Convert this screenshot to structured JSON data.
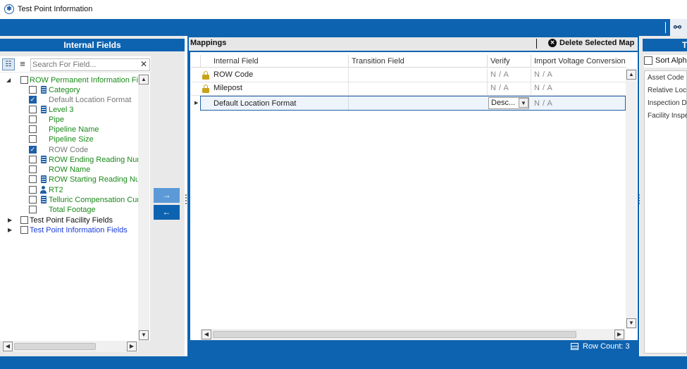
{
  "window": {
    "title": "Test Point Information",
    "app_icon": "asterisk-circle-icon"
  },
  "toolbar": {
    "right_icon": "binoculars-icon"
  },
  "left_panel": {
    "title": "Internal Fields",
    "search_placeholder": "Search For Field...",
    "clear_label": "✕",
    "tree": [
      {
        "label": "ROW Permanent Information Fie",
        "level": 0,
        "expanded": true,
        "checked": false,
        "color": "green"
      },
      {
        "label": "Category",
        "level": 1,
        "checked": false,
        "icon": "calculator-icon",
        "color": "green"
      },
      {
        "label": "Default Location Format",
        "level": 1,
        "checked": true,
        "color": "gray"
      },
      {
        "label": "Level 3",
        "level": 1,
        "checked": false,
        "icon": "calculator-icon",
        "color": "green"
      },
      {
        "label": "Pipe",
        "level": 1,
        "checked": false,
        "color": "green"
      },
      {
        "label": "Pipeline Name",
        "level": 1,
        "checked": false,
        "color": "green"
      },
      {
        "label": "Pipeline Size",
        "level": 1,
        "checked": false,
        "color": "green"
      },
      {
        "label": "ROW Code",
        "level": 1,
        "checked": true,
        "color": "gray"
      },
      {
        "label": "ROW Ending Reading Num",
        "level": 1,
        "checked": false,
        "icon": "calculator-icon",
        "color": "green"
      },
      {
        "label": "ROW Name",
        "level": 1,
        "checked": false,
        "color": "green"
      },
      {
        "label": "ROW Starting Reading Nur",
        "level": 1,
        "checked": false,
        "icon": "calculator-icon",
        "color": "green"
      },
      {
        "label": "RT2",
        "level": 1,
        "checked": false,
        "icon": "person-icon",
        "color": "green"
      },
      {
        "label": "Telluric Compensation Curr",
        "level": 1,
        "checked": false,
        "icon": "calculator-icon",
        "color": "green"
      },
      {
        "label": "Total Footage",
        "level": 1,
        "checked": false,
        "color": "green"
      },
      {
        "label": "Test Point Facility Fields",
        "level": 0,
        "expanded": false,
        "checked": false,
        "color": "dark"
      },
      {
        "label": "Test Point Information Fields",
        "level": 0,
        "expanded": false,
        "checked": false,
        "color": "blue"
      }
    ]
  },
  "transfer": {
    "add_label": "→",
    "remove_label": "←"
  },
  "mappings": {
    "title": "Mappings",
    "delete_label": "Delete Selected Map",
    "columns": [
      "Internal Field",
      "Transition Field",
      "Verify",
      "Import Voltage Conversion"
    ],
    "rows": [
      {
        "locked": true,
        "internal_field": "ROW Code",
        "transition_field": "",
        "verify": "N / A",
        "import_voltage": "N / A"
      },
      {
        "locked": true,
        "internal_field": "Milepost",
        "transition_field": "",
        "verify": "N / A",
        "import_voltage": "N / A"
      },
      {
        "locked": false,
        "selected": true,
        "internal_field": "Default Location Format",
        "transition_field": "",
        "verify": "Desc...",
        "import_voltage": "N / A"
      }
    ],
    "row_count": "Row Count:  3"
  },
  "right_panel": {
    "title": "T",
    "sort_label": "Sort Alpha",
    "items": [
      "Asset Code",
      "Relative Loc",
      "Inspection D",
      "Facility Inspe"
    ]
  },
  "colors": {
    "accent": "#0e63b0",
    "green_text": "#1a8a1a",
    "blue_text": "#1a3ed8",
    "lock": "#c8a21b"
  }
}
